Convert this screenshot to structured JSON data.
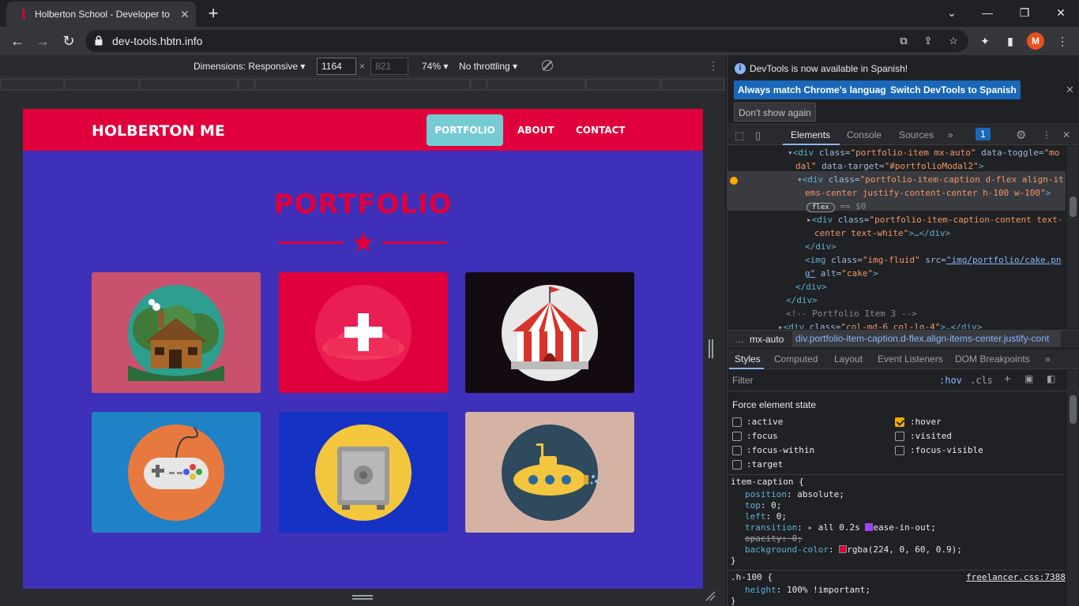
{
  "browser": {
    "tab_title": "Holberton School - Developer to",
    "tab_close": "✕",
    "new_tab": "+",
    "url": "dev-tools.hbtn.info",
    "avatar_initial": "M",
    "window": {
      "minimize": "—",
      "restore": "❐",
      "close": "✕",
      "tabsearch": "⌄"
    }
  },
  "device_toolbar": {
    "dimensions_label": "Dimensions: Responsive ▾",
    "width": "1164",
    "height": "821",
    "times": "×",
    "zoom": "74% ▾",
    "throttling": "No throttling ▾",
    "more": "⋮"
  },
  "site": {
    "brand": "HOLBERTON ME",
    "nav": {
      "portfolio": "PORTFOLIO",
      "about": "ABOUT",
      "contact": "CONTACT"
    },
    "heading": "PORTFOLIO",
    "tiles": [
      {
        "name": "cabin",
        "bg": "#c9516e"
      },
      {
        "name": "cake-hover",
        "bg": "#e0003c"
      },
      {
        "name": "circus",
        "bg": "#140b12"
      },
      {
        "name": "game",
        "bg": "#2082c6"
      },
      {
        "name": "safe",
        "bg": "#1432c4"
      },
      {
        "name": "submarine",
        "bg": "#d5b3a4"
      }
    ],
    "colors": {
      "nav": "#e0003c",
      "body": "#3e30b8",
      "accent": "#75cbd2"
    }
  },
  "devtools": {
    "info_text": "DevTools is now available in Spanish!",
    "btn_match": "Always match Chrome's language",
    "btn_switch": "Switch DevTools to Spanish",
    "btn_dont_show": "Don't show again",
    "close": "✕",
    "tabs": {
      "elements": "Elements",
      "console": "Console",
      "sources": "Sources",
      "more": "»",
      "issues": "1"
    },
    "dom": {
      "l1_tag": "<div ",
      "l1_attr1": "class=",
      "l1_val1": "\"portfolio-item mx-auto\"",
      "l1_attr2": " data-toggle=",
      "l1_val2": "\"mo",
      "l2_val": "dal\"",
      "l2_attr": " data-target=",
      "l2_val2": "\"#portfolioModal2\"",
      "l2_tag": ">",
      "l3_tag": "<div ",
      "l3_attr": "class=",
      "l3_val": "\"portfolio-item-caption d-flex align-it",
      "l4_val": "ems-center justify-content-center h-100 w-100\"",
      "l4_tag": ">",
      "l5_badge": "flex",
      "l5_eq": "== $0",
      "l6_tag": "<div ",
      "l6_attr": "class=",
      "l6_val": "\"portfolio-item-caption-content text-",
      "l7_val": "center text-white\"",
      "l7_tag": ">…</div>",
      "l8": "</div>",
      "l9_tag": "<img ",
      "l9_attr1": "class=",
      "l9_val1": "\"img-fluid\"",
      "l9_attr2": " src=",
      "l9_val2": "\"img/portfolio/cake.pn",
      "l10_val": "g\"",
      "l10_attr": " alt=",
      "l10_val2": "\"cake\"",
      "l10_tag": ">",
      "l11": "</div>",
      "l12": "</div>",
      "l13": "<!-- Portfolio Item 3 -->",
      "l14_tag": "<div ",
      "l14_attr": "class=",
      "l14_val": "\"col-md-6 col-lg-4\"",
      "l14_end": ">…</div>"
    },
    "breadcrumb": {
      "dots": "…",
      "b1": "mx-auto",
      "b2": "div.portfolio-item-caption.d-flex.align-items-center.justify-cont"
    },
    "style_tabs": {
      "styles": "Styles",
      "computed": "Computed",
      "layout": "Layout",
      "listeners": "Event Listeners",
      "dom_bp": "DOM Breakpoints",
      "more": "»"
    },
    "filter_placeholder": "Filter",
    "hov": ":hov",
    "cls": ".cls",
    "force_title": "Force element state",
    "states": [
      {
        "label": ":active",
        "checked": false
      },
      {
        "label": ":hover",
        "checked": true
      },
      {
        "label": ":focus",
        "checked": false
      },
      {
        "label": ":visited",
        "checked": false
      },
      {
        "label": ":focus-within",
        "checked": false
      },
      {
        "label": ":focus-visible",
        "checked": false
      },
      {
        "label": ":target",
        "checked": false
      }
    ],
    "css": {
      "sel1": "item-caption {",
      "p1": "position",
      "v1": "absolute;",
      "p2": "top",
      "v2": "0;",
      "p3": "left",
      "v3": "0;",
      "p4": "transition",
      "v4": "all 0.2s ",
      "v4b": "ease-in-out;",
      "p5": "opacity: 0;",
      "p6": "background-color",
      "v6": "rgba(224, 0, 60, 0.9);",
      "close1": "}",
      "sel2": ".h-100 {",
      "link2": "freelancer.css:7388",
      "p7": "height",
      "v7": "100% !important;",
      "close2": "}"
    }
  }
}
